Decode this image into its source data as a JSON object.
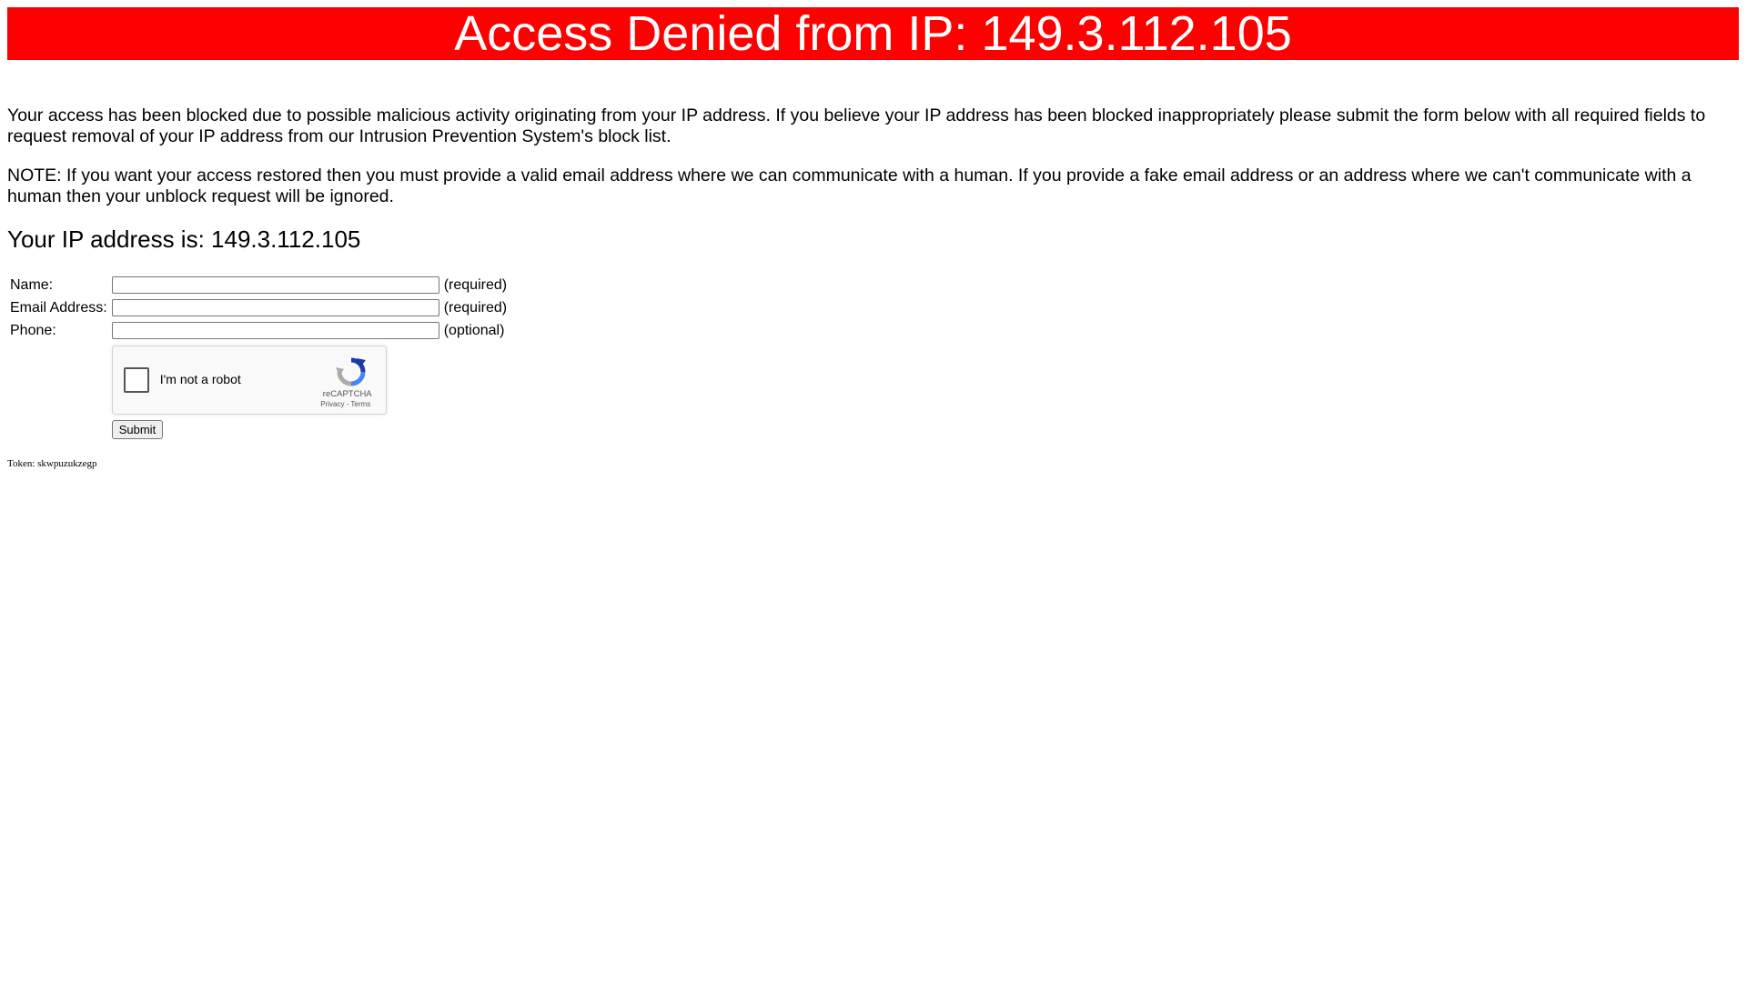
{
  "banner": {
    "title": "Access Denied from IP: 149.3.112.105",
    "background_color": "#ff0000",
    "text_color": "#ffffff"
  },
  "content": {
    "paragraph1": "Your access has been blocked due to possible malicious activity originating from your IP address. If you believe your IP address has been blocked inappropriately please submit the form below with all required fields to request removal of your IP address from our Intrusion Prevention System's block list.",
    "paragraph2": "NOTE: If you want your access restored then you must provide a valid email address where we can communicate with a human. If you provide a fake email address or an address where we can't communicate with a human then your unblock request will be ignored.",
    "ip_heading": "Your IP address is: 149.3.112.105"
  },
  "form": {
    "name": {
      "label": "Name:",
      "value": "",
      "note": "(required)"
    },
    "email": {
      "label": "Email Address:",
      "value": "",
      "note": "(required)"
    },
    "phone": {
      "label": "Phone:",
      "value": "",
      "note": "(optional)"
    },
    "submit_label": "Submit"
  },
  "recaptcha": {
    "checkbox_label": "I'm not a robot",
    "brand": "reCAPTCHA",
    "links": "Privacy - Terms",
    "icon": "recaptcha-logo-icon"
  },
  "footer": {
    "token": "Token: skwpuzukzegp"
  }
}
